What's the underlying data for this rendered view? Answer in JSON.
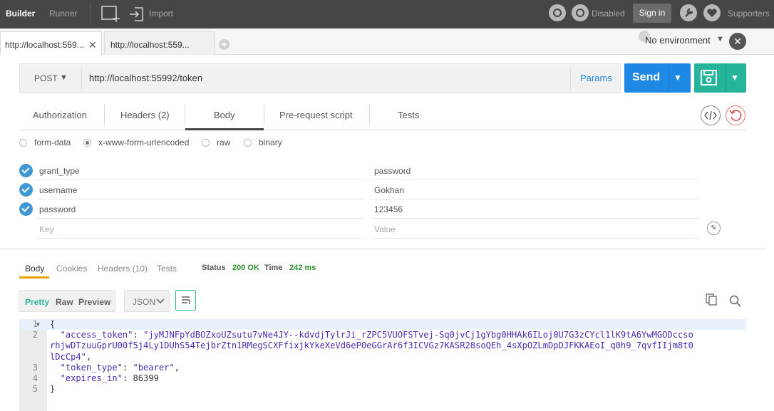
{
  "topbar": {
    "builder": "Builder",
    "runner": "Runner",
    "import": "Import",
    "disabled": "Disabled",
    "signin": "Sign in",
    "supporters": "Supporters"
  },
  "tabs": [
    {
      "label": "http://localhost:559..."
    },
    {
      "label": "http://localhost:559..."
    }
  ],
  "environment": "No environment",
  "request": {
    "method": "POST",
    "url": "http://localhost:55992/token",
    "params_label": "Params",
    "send_label": "Send"
  },
  "request_tabs": [
    "Authorization",
    "Headers (2)",
    "Body",
    "Pre-request script",
    "Tests"
  ],
  "body_types": [
    "form-data",
    "x-www-form-urlencoded",
    "raw",
    "binary"
  ],
  "selected_body_type": "x-www-form-urlencoded",
  "form_rows": [
    {
      "key": "grant_type",
      "value": "password"
    },
    {
      "key": "username",
      "value": "Gokhan"
    },
    {
      "key": "password",
      "value": "123456"
    }
  ],
  "form_placeholder": {
    "key": "Key",
    "value": "Value"
  },
  "response": {
    "tabs": [
      "Body",
      "Cookies",
      "Headers (10)",
      "Tests"
    ],
    "status_label": "Status",
    "status_value": "200 OK",
    "time_label": "Time",
    "time_value": "242 ms",
    "view_modes": [
      "Pretty",
      "Raw",
      "Preview"
    ],
    "format": "JSON"
  },
  "code": {
    "line_numbers": [
      "1",
      "2",
      "3",
      "4",
      "5"
    ],
    "open_brace": "{",
    "close_brace": "}",
    "access_token_key": "\"access_token\"",
    "access_token_part1": "\"jyMJNFpYdBOZxoUZsutu7vNe4JY--kdvdjTylrJi_rZPC5VUOFSTvej-Sq0jvCj1gYbg0HHAk6ILoj0U7G3zCYcl1lK9tA6YwMGODccso",
    "access_token_part2": "rhjwDTzuuGprU00f5j4Ly1DUhS54TejbrZtn1RMegSCXFfixjkYkeXeVd6eP0eGGrAr6f3ICVGz7KASR28soQEh_4sXpOZLmDpDJFKKAEoI_q0h9_7qvfIIjm8t0",
    "access_token_part3": "lDcCp4\"",
    "token_type_key": "\"token_type\"",
    "token_type_value": "\"bearer\"",
    "expires_in_key": "\"expires_in\"",
    "expires_in_value": "86399"
  },
  "colors": {
    "send": "#1e88e5",
    "save": "#26b59a",
    "status": "#2f8f2f",
    "active_tab": "#f0a100"
  }
}
